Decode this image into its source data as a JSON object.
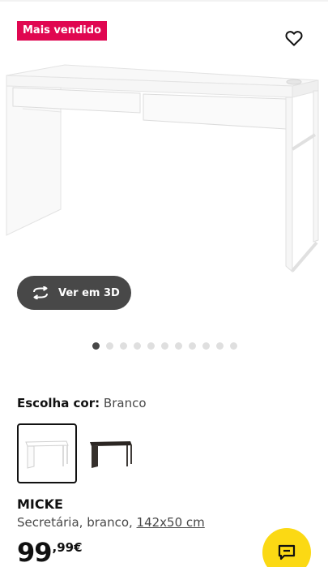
{
  "badge": {
    "label": "Mais vendido"
  },
  "actions": {
    "favourite_icon": "heart-icon",
    "view_3d_label": "Ver em 3D",
    "view_3d_icon": "rotate-3d-icon"
  },
  "carousel": {
    "total": 11,
    "active_index": 0
  },
  "color_selector": {
    "label": "Escolha cor:",
    "selected_value": "Branco",
    "options": [
      {
        "name": "Branco",
        "color": "#ffffff",
        "selected": true
      },
      {
        "name": "Preto-castanho",
        "color": "#2b2623",
        "selected": false
      }
    ]
  },
  "product": {
    "name": "MICKE",
    "description_prefix": "Secretária, branco, ",
    "dimensions": "142x50 cm",
    "price_integer": "99",
    "price_decimal": ",99€"
  },
  "colors": {
    "badge": "#e00751",
    "button_dark": "#484848",
    "chat": "#fbd914"
  },
  "chat": {
    "icon": "chat-icon"
  }
}
